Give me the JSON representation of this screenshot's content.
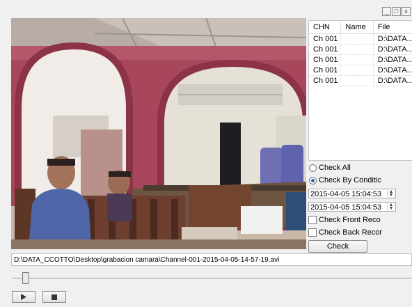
{
  "window_controls": {
    "minimize": "_",
    "maximize": "□",
    "close": "x"
  },
  "recordings": {
    "headers": [
      "CHN",
      "Name",
      "File"
    ],
    "rows": [
      {
        "chn": "Ch 001",
        "name": "",
        "file": "D:\\DATA..."
      },
      {
        "chn": "Ch 001",
        "name": "",
        "file": "D:\\DATA..."
      },
      {
        "chn": "Ch 001",
        "name": "",
        "file": "D:\\DATA..."
      },
      {
        "chn": "Ch 001",
        "name": "",
        "file": "D:\\DATA..."
      },
      {
        "chn": "Ch 001",
        "name": "",
        "file": "D:\\DATA..."
      }
    ]
  },
  "filter": {
    "check_all": "Check All",
    "check_by_condition": "Check By Conditic",
    "selected": "check_by_condition",
    "start_time": "2015-04-05 15:04:53",
    "end_time": "2015-04-05 15:04:53",
    "front_record": "Check Front Reco",
    "back_record": "Check Back Recor",
    "check_button": "Check"
  },
  "player": {
    "file_path": "D:\\DATA_CCOTTO\\Desktop\\grabacion camara\\Channel-001-2015-04-05-14-57-19.avi",
    "position_fraction": 0.03,
    "play_icon": "play-icon",
    "stop_icon": "stop-icon"
  }
}
